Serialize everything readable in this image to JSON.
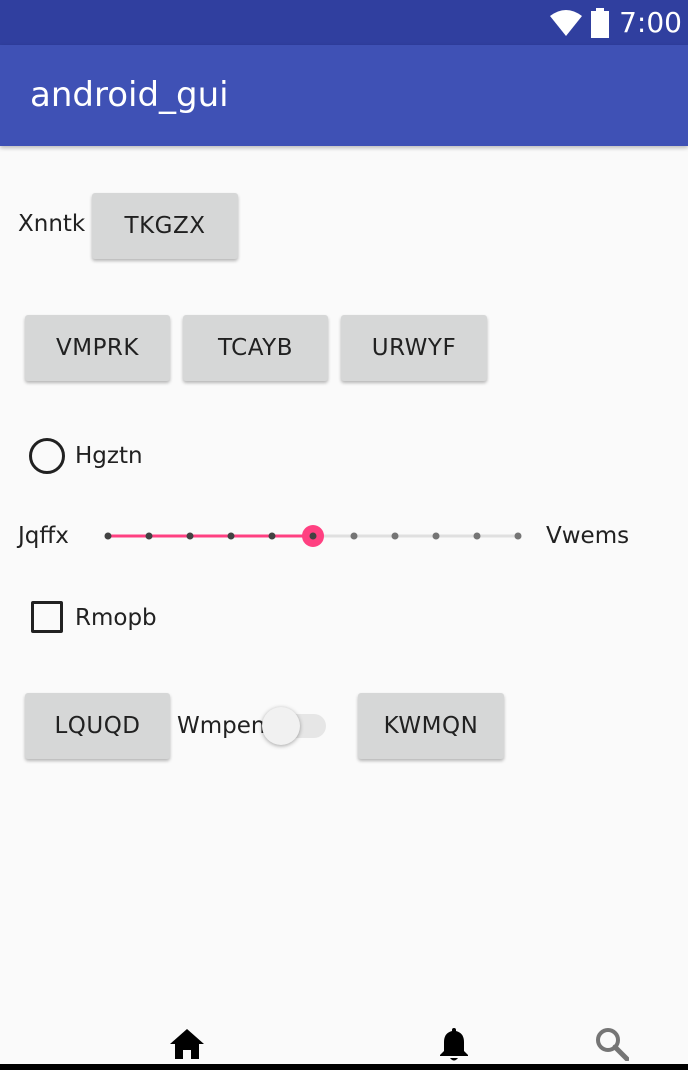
{
  "status_bar": {
    "time": "7:00",
    "icons": [
      "wifi-icon",
      "battery-icon"
    ],
    "color": "#303f9f"
  },
  "app_bar": {
    "title": "android_gui",
    "color": "#3f51b5"
  },
  "row1": {
    "label": "Xnntk",
    "button": "TKGZX"
  },
  "row2": {
    "buttons": [
      "VMPRK",
      "TCAYB",
      "URWYF"
    ]
  },
  "radio": {
    "label": "Hgztn",
    "checked": false
  },
  "slider": {
    "min_label": "Jqffx",
    "max_label": "Vwems",
    "steps": 10,
    "value": 5,
    "accent": "#ff4081"
  },
  "checkbox": {
    "label": "Rmopb",
    "checked": false
  },
  "row3": {
    "button_left": "LQUQD",
    "switch_label": "Wmpen",
    "switch_on": false,
    "button_right": "KWMQN"
  },
  "bottom_nav": {
    "icons": [
      "home-icon",
      "bell-icon",
      "search-icon"
    ]
  }
}
